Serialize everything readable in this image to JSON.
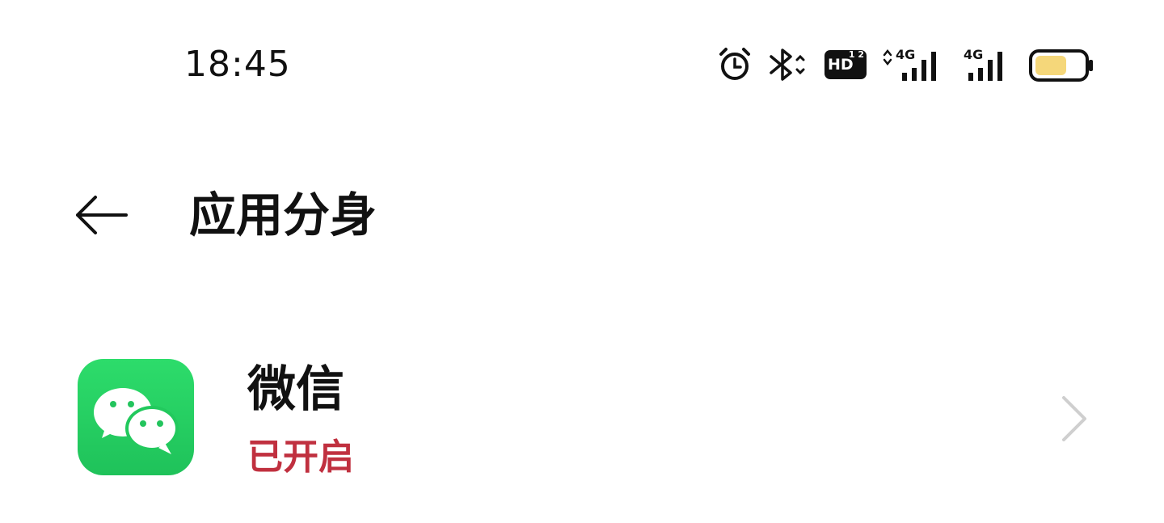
{
  "status_bar": {
    "time": "18:45",
    "icons": [
      "alarm-icon",
      "bluetooth-icon",
      "hd-voice-icon",
      "signal-4g-icon",
      "signal-4g-icon",
      "battery-icon"
    ],
    "network_1": "4G",
    "network_2": "4G",
    "hd_label": "HD",
    "hd_sup": "1 2",
    "battery_color": "#f5d77a"
  },
  "header": {
    "back_icon": "arrow-left-icon",
    "title": "应用分身"
  },
  "apps": [
    {
      "name": "微信",
      "status": "已开启",
      "status_color": "#c0303f",
      "icon": "wechat-icon",
      "icon_color": "#22c95d",
      "chevron": "chevron-right-icon"
    }
  ]
}
